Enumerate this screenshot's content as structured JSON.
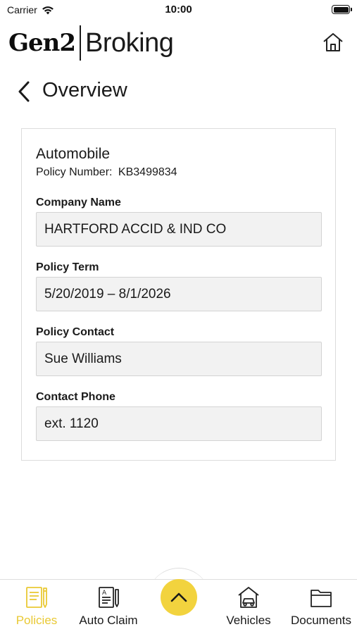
{
  "status_bar": {
    "carrier": "Carrier",
    "time": "10:00"
  },
  "header": {
    "logo_brand": "Gen2",
    "logo_product": "Broking",
    "home_icon": "home-icon"
  },
  "nav": {
    "title": "Overview",
    "back_icon": "chevron-left-icon"
  },
  "policy": {
    "type": "Automobile",
    "number_label": "Policy Number:",
    "number": "KB3499834",
    "fields": [
      {
        "label": "Company Name",
        "value": "HARTFORD ACCID & IND CO"
      },
      {
        "label": "Policy Term",
        "value": "5/20/2019 – 8/1/2026"
      },
      {
        "label": "Policy Contact",
        "value": "Sue Williams"
      },
      {
        "label": "Contact Phone",
        "value": "ext. 1120"
      }
    ]
  },
  "tabs": [
    {
      "label": "Policies",
      "icon": "policies-icon",
      "active": true
    },
    {
      "label": "Auto Claim",
      "icon": "auto-claim-icon",
      "active": false
    },
    {
      "label": "Vehicles",
      "icon": "vehicles-icon",
      "active": false
    },
    {
      "label": "Documents",
      "icon": "documents-icon",
      "active": false
    }
  ],
  "fab_icon": "chevron-up-icon",
  "colors": {
    "accent": "#f2d33e",
    "active_tab": "#e9c934",
    "field_background": "#f2f2f2",
    "card_border": "#dcdcdc"
  }
}
